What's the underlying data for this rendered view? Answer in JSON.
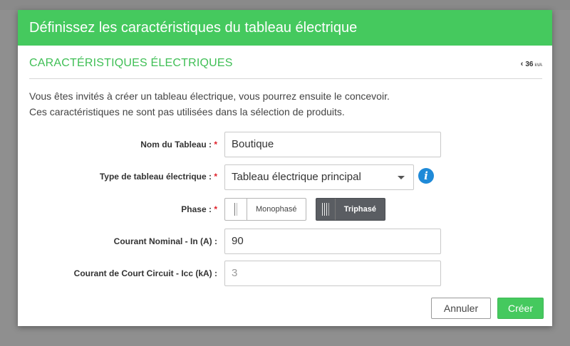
{
  "modal": {
    "title": "Définissez les caractéristiques du tableau électrique",
    "section_title": "CARACTÉRISTIQUES ÉLECTRIQUES",
    "power": {
      "value": "36",
      "unit": "kVA"
    },
    "intro_line1": "Vous êtes invités à créer un tableau électrique, vous pourrez ensuite le concevoir.",
    "intro_line2": "Ces caractéristiques ne sont pas utilisées dans la sélection de produits."
  },
  "form": {
    "name": {
      "label": "Nom du Tableau :",
      "required_mark": "*",
      "value": "Boutique"
    },
    "type": {
      "label": "Type de tableau électrique :",
      "required_mark": "*",
      "value": "Tableau électrique principal"
    },
    "phase": {
      "label": "Phase :",
      "required_mark": "*",
      "options": [
        "Monophasé",
        "Triphasé"
      ],
      "selected": "Triphasé"
    },
    "nominal_current": {
      "label": "Courant Nominal - In (A) :",
      "value": "90"
    },
    "short_circuit": {
      "label": "Courant de Court Circuit - Icc (kA) :",
      "value": "3"
    }
  },
  "actions": {
    "cancel": "Annuler",
    "create": "Créer"
  },
  "colors": {
    "accent": "#45c95e",
    "required": "#e0202a",
    "info": "#1f8ad8",
    "selected_phase": "#5a5d62"
  },
  "icons": {
    "back": "chevron-left-icon",
    "info": "info-icon",
    "mono": "single-phase-icon",
    "tri": "three-phase-icon"
  }
}
